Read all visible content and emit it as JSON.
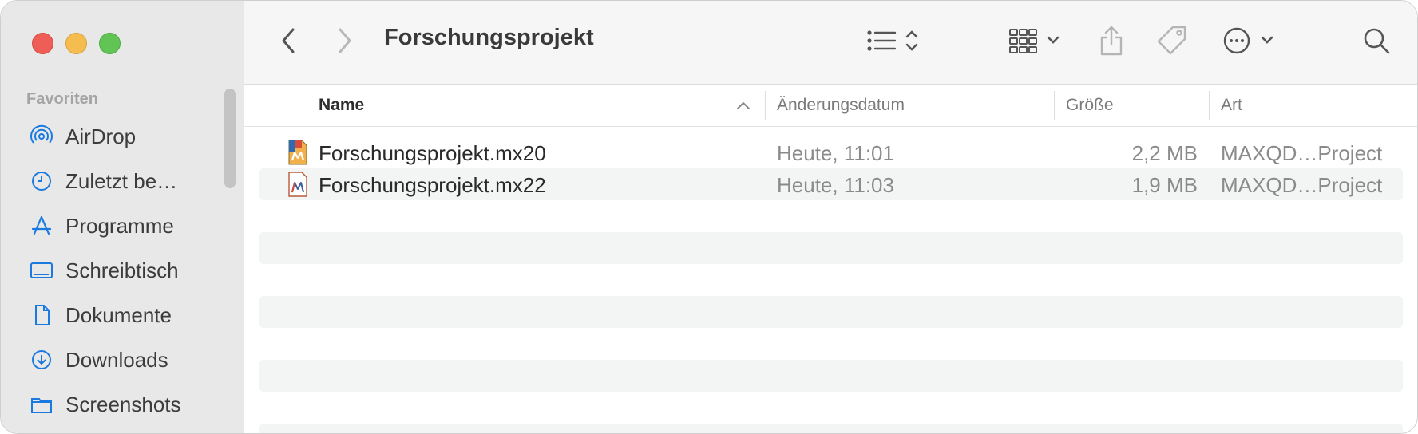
{
  "window": {
    "title": "Forschungsprojekt"
  },
  "sidebar": {
    "section_label": "Favoriten",
    "items": [
      {
        "label": "AirDrop",
        "icon": "airdrop-icon"
      },
      {
        "label": "Zuletzt be…",
        "icon": "clock-icon"
      },
      {
        "label": "Programme",
        "icon": "apps-icon"
      },
      {
        "label": "Schreibtisch",
        "icon": "desktop-icon"
      },
      {
        "label": "Dokumente",
        "icon": "document-icon"
      },
      {
        "label": "Downloads",
        "icon": "download-icon"
      },
      {
        "label": "Screenshots",
        "icon": "folder-icon"
      }
    ]
  },
  "columns": {
    "name": "Name",
    "date": "Änderungsdatum",
    "size": "Größe",
    "kind": "Art"
  },
  "files": [
    {
      "name": "Forschungsprojekt.mx20",
      "date": "Heute, 11:01",
      "size": "2,2 MB",
      "kind": "MAXQD…Project"
    },
    {
      "name": "Forschungsprojekt.mx22",
      "date": "Heute, 11:03",
      "size": "1,9 MB",
      "kind": "MAXQD…Project"
    }
  ],
  "colors": {
    "accent": "#1a7ae0",
    "sidebar_bg": "#e8e8e8",
    "toolbar_bg": "#f6f6f6"
  }
}
